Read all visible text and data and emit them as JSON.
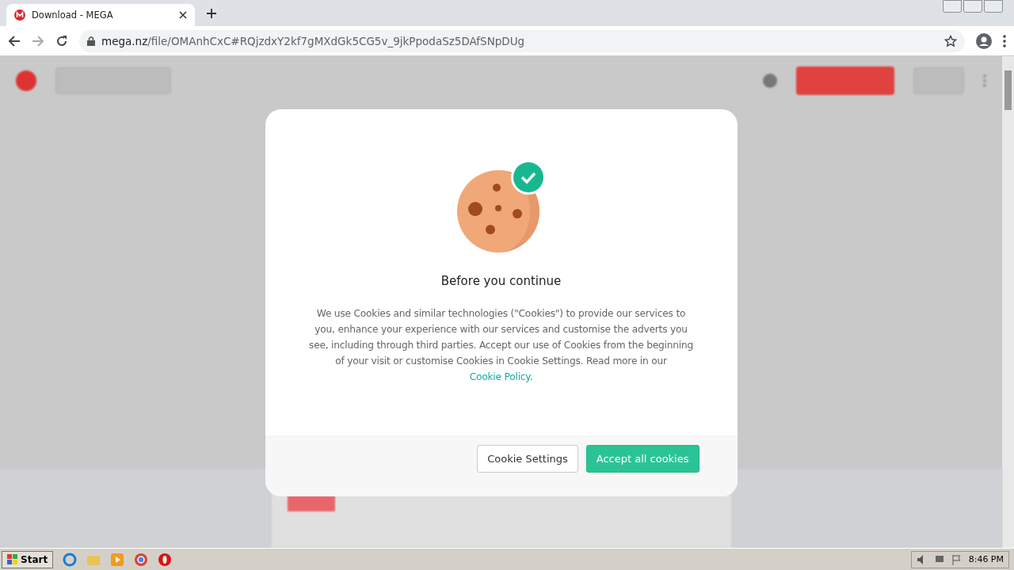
{
  "browser": {
    "tab": {
      "title": "Download - MEGA"
    },
    "url_host": "mega.nz",
    "url_path": "/file/OMAnhCxC#RQjzdxY2kf7gMXdGk5CG5v_9jkPpodaSz5DAfSNpDUg"
  },
  "dialog": {
    "title": "Before you continue",
    "body": "We use Cookies and similar technologies (\"Cookies\") to provide our services to you, enhance your experience with our services and customise the adverts you see, including through third parties. Accept our use of Cookies from the beginning of your visit or customise Cookies in Cookie Settings. Read more in our",
    "link": "Cookie Policy",
    "link_after": ".",
    "buttons": [
      {
        "label": "Cookie Settings",
        "kind": "secondary"
      },
      {
        "label": "Accept all cookies",
        "kind": "primary"
      }
    ]
  },
  "taskbar": {
    "start": "Start",
    "clock": "8:46 PM"
  }
}
